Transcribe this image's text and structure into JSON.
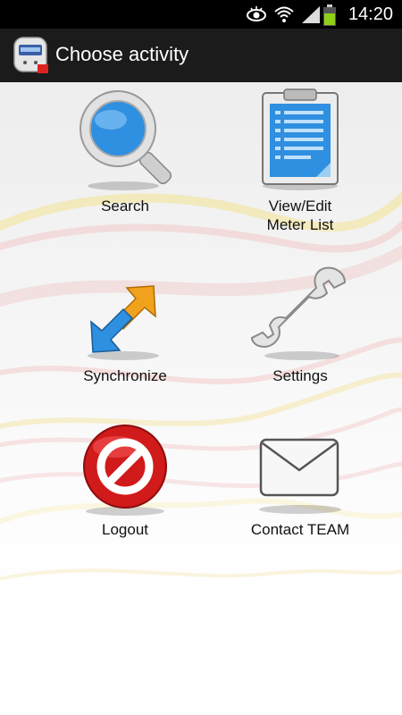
{
  "status_bar": {
    "time": "14:20",
    "icons": [
      "eye-icon",
      "wifi-icon",
      "signal-icon",
      "battery-icon"
    ]
  },
  "action_bar": {
    "title": "Choose activity",
    "app_icon": "meter-icon"
  },
  "activities": [
    {
      "label": "Search",
      "icon": "magnifier-icon"
    },
    {
      "label": "View/Edit\nMeter List",
      "icon": "clipboard-icon"
    },
    {
      "label": "Synchronize",
      "icon": "sync-arrows-icon"
    },
    {
      "label": "Settings",
      "icon": "wrench-icon"
    },
    {
      "label": "Logout",
      "icon": "stop-sign-icon"
    },
    {
      "label": "Contact TEAM",
      "icon": "envelope-icon"
    }
  ],
  "colors": {
    "action_bar_bg": "#1b1b1b",
    "status_bar_bg": "#000000",
    "accent_blue": "#2f8fe0",
    "logout_red": "#d11a1a",
    "battery_green": "#8fcf1a"
  }
}
